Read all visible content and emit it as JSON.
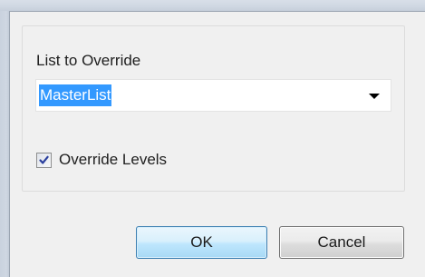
{
  "list_section": {
    "label": "List to Override",
    "combo_value": "MasterList"
  },
  "override_levels": {
    "label": "Override Levels",
    "checked": true
  },
  "buttons": {
    "ok": "OK",
    "cancel": "Cancel"
  },
  "colors": {
    "selection": "#3399ff",
    "dialog_background": "#f0f0f0"
  }
}
